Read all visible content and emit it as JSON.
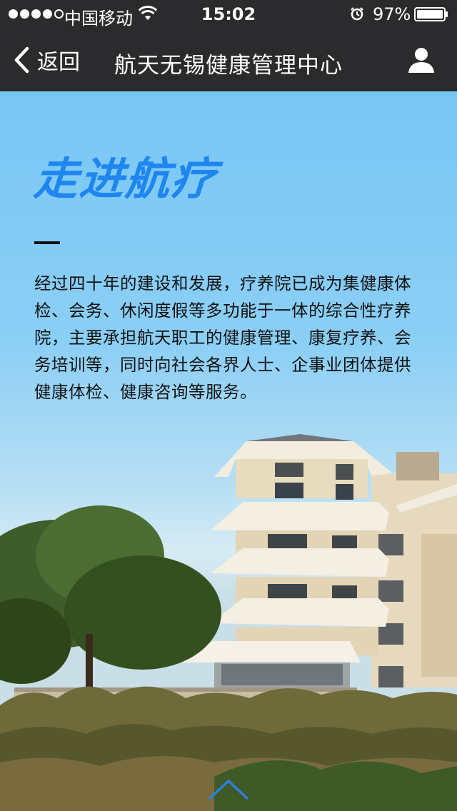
{
  "status_bar": {
    "carrier": "中国移动",
    "time": "15:02",
    "battery_percent": "97%",
    "signal_bars": 4,
    "signal_max": 5,
    "battery_level": 0.97
  },
  "nav": {
    "back_label": "返回",
    "title": "航天无锡健康管理中心",
    "back_icon": "chevron-left-icon",
    "profile_icon": "user-icon"
  },
  "hero": {
    "title": "走进航疗",
    "description": "经过四十年的建设和发展，疗养院已成为集健康体检、会务、休闲度假等多功能于一体的综合性疗养院，主要承担航天职工的健康管理、康复疗养、会务培训等，同时向社会各界人士、企事业团体提供健康体检、健康咨询等服务。",
    "scroll_icon": "chevron-up-icon"
  },
  "colors": {
    "bar_background": "#2b2b2d",
    "title_blue": "#1e86ee",
    "sky_blue": "#7cc5f2"
  }
}
